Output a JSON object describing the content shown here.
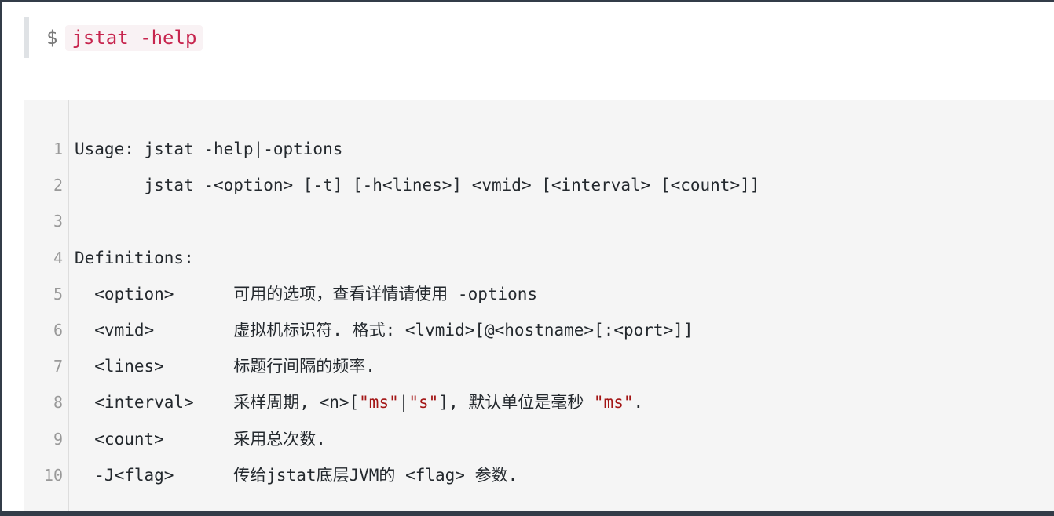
{
  "command": {
    "prompt": "$",
    "text": "jstat -help"
  },
  "code": {
    "lines": [
      {
        "n": "1",
        "parts": [
          {
            "t": "Usage: jstat -help|-options"
          }
        ]
      },
      {
        "n": "2",
        "parts": [
          {
            "t": "       jstat -<option> [-t] [-h<lines>] <vmid> [<interval> [<count>]]"
          }
        ]
      },
      {
        "n": "3",
        "parts": [
          {
            "t": ""
          }
        ]
      },
      {
        "n": "4",
        "parts": [
          {
            "t": "Definitions:"
          }
        ]
      },
      {
        "n": "5",
        "parts": [
          {
            "t": "  <option>      可用的选项，查看详情请使用 -options"
          }
        ]
      },
      {
        "n": "6",
        "parts": [
          {
            "t": "  <vmid>        虚拟机标识符. 格式: <lvmid>[@<hostname>[:<port>]]"
          }
        ]
      },
      {
        "n": "7",
        "parts": [
          {
            "t": "  <lines>       标题行间隔的频率."
          }
        ]
      },
      {
        "n": "8",
        "parts": [
          {
            "t": "  <interval>    采样周期, <n>["
          },
          {
            "t": "\"ms\"",
            "s": true
          },
          {
            "t": "|"
          },
          {
            "t": "\"s\"",
            "s": true
          },
          {
            "t": "], 默认单位是毫秒 "
          },
          {
            "t": "\"ms\"",
            "s": true
          },
          {
            "t": "."
          }
        ]
      },
      {
        "n": "9",
        "parts": [
          {
            "t": "  <count>       采用总次数."
          }
        ]
      },
      {
        "n": "10",
        "parts": [
          {
            "t": "  -J<flag>      传给jstat底层JVM的 <flag> 参数."
          }
        ]
      }
    ]
  }
}
